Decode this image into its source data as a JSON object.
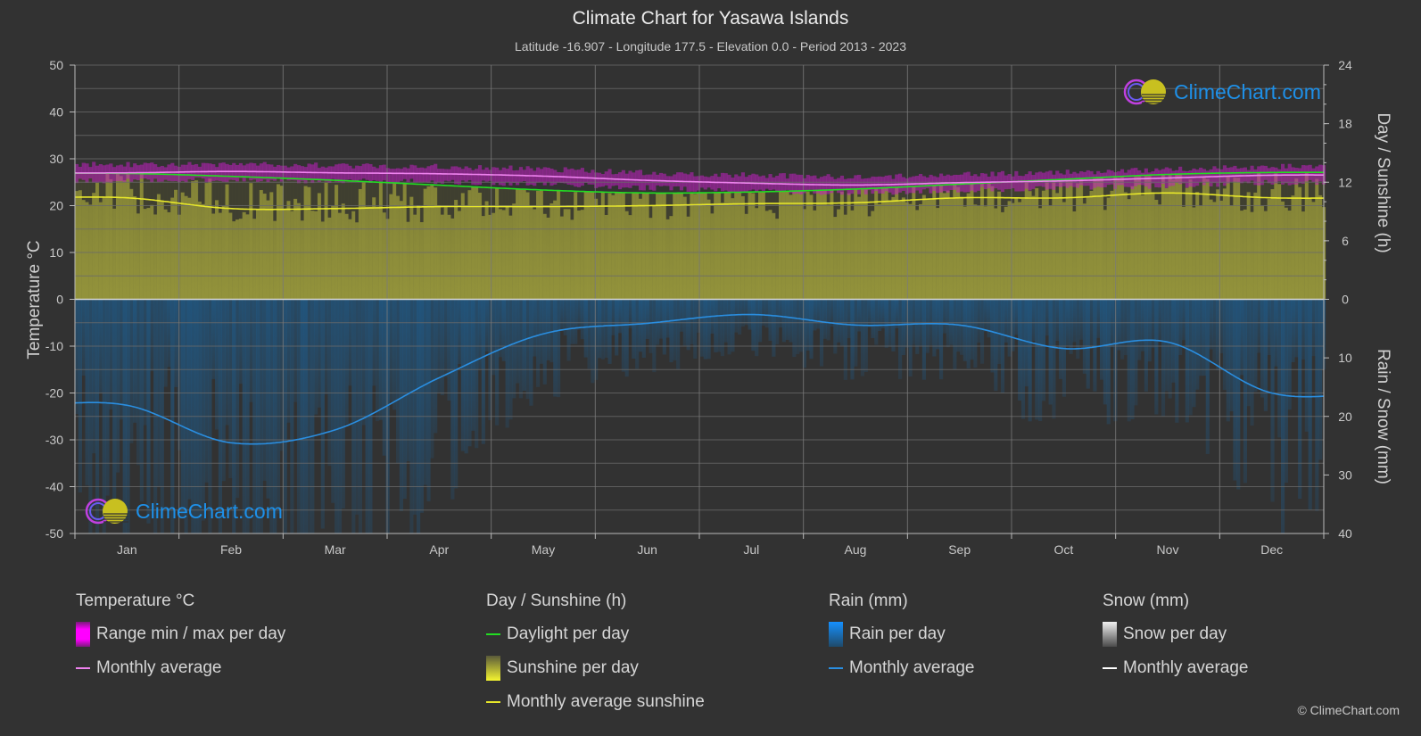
{
  "header": {
    "title": "Climate Chart for Yasawa Islands",
    "subtitle": "Latitude -16.907 - Longitude 177.5 - Elevation 0.0 - Period 2013 - 2023"
  },
  "chart_data": {
    "type": "line",
    "title": "Climate Chart for Yasawa Islands",
    "categories": [
      "Jan",
      "Feb",
      "Mar",
      "Apr",
      "May",
      "Jun",
      "Jul",
      "Aug",
      "Sep",
      "Oct",
      "Nov",
      "Dec"
    ],
    "axes": {
      "left": {
        "label": "Temperature °C",
        "min": -50,
        "max": 50,
        "ticks": [
          "50",
          "40",
          "30",
          "20",
          "10",
          "0",
          "-10",
          "-20",
          "-30",
          "-40",
          "-50"
        ]
      },
      "right_top": {
        "label": "Day / Sunshine (h)",
        "min": 0,
        "max": 24,
        "ticks": [
          "24",
          "18",
          "12",
          "6",
          "0"
        ]
      },
      "right_bottom": {
        "label": "Rain / Snow (mm)",
        "min": 0,
        "max": 40,
        "ticks": [
          "10",
          "20",
          "30",
          "40"
        ]
      }
    },
    "grid": true,
    "series": [
      {
        "name": "Temperature monthly average",
        "unit": "°C",
        "color": "#ee82ee",
        "values": [
          27.0,
          27.3,
          27.0,
          26.8,
          26.3,
          25.4,
          24.8,
          24.4,
          24.9,
          25.3,
          25.9,
          26.5
        ]
      },
      {
        "name": "Temperature range max per day (approx.)",
        "unit": "°C",
        "color": "#b020b0",
        "values": [
          28.8,
          28.8,
          28.6,
          28.3,
          27.8,
          27.0,
          26.5,
          26.2,
          26.6,
          27.1,
          27.7,
          28.3
        ]
      },
      {
        "name": "Temperature range min per day (approx.)",
        "unit": "°C",
        "color": "#b020b0",
        "values": [
          25.3,
          25.5,
          25.3,
          25.1,
          24.6,
          23.8,
          23.2,
          22.8,
          23.3,
          23.8,
          24.3,
          24.9
        ]
      },
      {
        "name": "Daylight per day",
        "unit": "h",
        "color": "#22dd22",
        "values": [
          12.9,
          12.6,
          12.2,
          11.7,
          11.2,
          10.9,
          11.0,
          11.3,
          11.8,
          12.3,
          12.8,
          13.0
        ]
      },
      {
        "name": "Monthly average sunshine",
        "unit": "h",
        "color": "#e8e82a",
        "values": [
          10.4,
          9.3,
          9.3,
          9.5,
          9.5,
          9.6,
          9.8,
          9.9,
          10.4,
          10.4,
          10.9,
          10.4
        ]
      },
      {
        "name": "Rain monthly average",
        "unit": "mm",
        "color": "#2a8ee0",
        "values": [
          18.1,
          24.5,
          22.3,
          13.4,
          5.9,
          4.1,
          2.6,
          4.4,
          4.4,
          8.4,
          7.3,
          16.0
        ]
      },
      {
        "name": "Snow monthly average",
        "unit": "mm",
        "color": "#ffffff",
        "values": [
          0,
          0,
          0,
          0,
          0,
          0,
          0,
          0,
          0,
          0,
          0,
          0
        ]
      }
    ]
  },
  "legend": {
    "temperature": {
      "head": "Temperature °C",
      "items": [
        "Range min / max per day",
        "Monthly average"
      ]
    },
    "sunshine": {
      "head": "Day / Sunshine (h)",
      "items": [
        "Daylight per day",
        "Sunshine per day",
        "Monthly average sunshine"
      ]
    },
    "rain": {
      "head": "Rain (mm)",
      "items": [
        "Rain per day",
        "Monthly average"
      ]
    },
    "snow": {
      "head": "Snow (mm)",
      "items": [
        "Snow per day",
        "Monthly average"
      ]
    }
  },
  "colors": {
    "background": "#323232",
    "temp_range": "#c020c0",
    "temp_avg": "#ee82ee",
    "daylight": "#22dd22",
    "sunshine_fill": "#9a9a38",
    "sunshine_avg": "#e8e82a",
    "rain_fill": "#1f5a88",
    "rain_avg": "#2a8ee0",
    "brand": "#1e90e8"
  },
  "branding": {
    "logo_text": "ClimeChart.com",
    "copyright": "© ClimeChart.com"
  }
}
